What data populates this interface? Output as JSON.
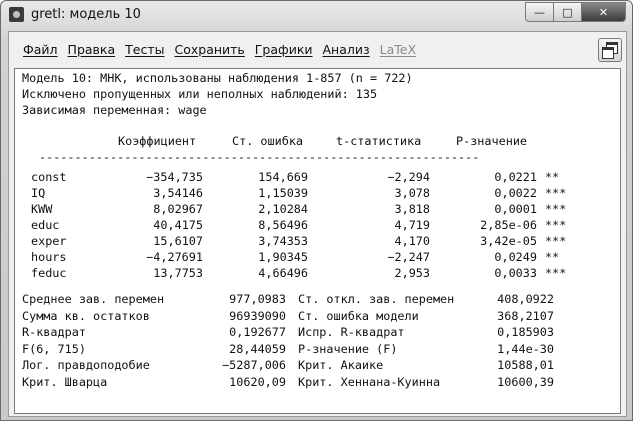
{
  "window": {
    "title": "gretl: модель 10",
    "controls": {
      "minimize": "—",
      "maximize": "□",
      "close": "✕"
    }
  },
  "menubar": {
    "items": [
      {
        "label": "Файл",
        "enabled": true
      },
      {
        "label": "Правка",
        "enabled": true
      },
      {
        "label": "Тесты",
        "enabled": true
      },
      {
        "label": "Сохранить",
        "enabled": true
      },
      {
        "label": "Графики",
        "enabled": true
      },
      {
        "label": "Анализ",
        "enabled": true
      },
      {
        "label": "LaTeX",
        "enabled": false
      }
    ]
  },
  "model": {
    "line1": "Модель 10: МНК, использованы наблюдения 1-857 (n = 722)",
    "line2": "Исключено пропущенных или неполных наблюдений: 135",
    "line3": "Зависимая переменная: wage"
  },
  "coef_table": {
    "headers": [
      "Коэффициент",
      "Ст. ошибка",
      "t-статистика",
      "P-значение"
    ],
    "separator": "--------------------------------------------------------------",
    "rows": [
      {
        "var": "const",
        "coef": "−354,735",
        "se": "154,669",
        "t": "−2,294",
        "p": "0,0221",
        "stars": "**"
      },
      {
        "var": "IQ",
        "coef": "3,54146",
        "se": "1,15039",
        "t": "3,078",
        "p": "0,0022",
        "stars": "***"
      },
      {
        "var": "KWW",
        "coef": "8,02967",
        "se": "2,10284",
        "t": "3,818",
        "p": "0,0001",
        "stars": "***"
      },
      {
        "var": "educ",
        "coef": "40,4175",
        "se": "8,56496",
        "t": "4,719",
        "p": "2,85e-06",
        "stars": "***"
      },
      {
        "var": "exper",
        "coef": "15,6107",
        "se": "3,74353",
        "t": "4,170",
        "p": "3,42e-05",
        "stars": "***"
      },
      {
        "var": "hours",
        "coef": "−4,27691",
        "se": "1,90345",
        "t": "−2,247",
        "p": "0,0249",
        "stars": "**"
      },
      {
        "var": "feduc",
        "coef": "13,7753",
        "se": "4,66496",
        "t": "2,953",
        "p": "0,0033",
        "stars": "***"
      }
    ]
  },
  "stats": [
    {
      "l_label": "Среднее зав. перемен",
      "l_value": "977,0983",
      "r_label": "Ст. откл. зав. перемен",
      "r_value": "408,0922"
    },
    {
      "l_label": "Сумма кв. остатков",
      "l_value": "96939090",
      "r_label": "Ст. ошибка модели",
      "r_value": "368,2107"
    },
    {
      "l_label": "R-квадрат",
      "l_value": "0,192677",
      "r_label": "Испр. R-квадрат",
      "r_value": "0,185903"
    },
    {
      "l_label": "F(6, 715)",
      "l_value": "28,44059",
      "r_label": "Р-значение (F)",
      "r_value": "1,44e-30"
    },
    {
      "l_label": "Лог. правдоподобие",
      "l_value": "−5287,006",
      "r_label": "Крит. Акаике",
      "r_value": "10588,01"
    },
    {
      "l_label": "Крит. Шварца",
      "l_value": "10620,09",
      "r_label": "Крит. Хеннана-Куинна",
      "r_value": "10600,39"
    }
  ]
}
